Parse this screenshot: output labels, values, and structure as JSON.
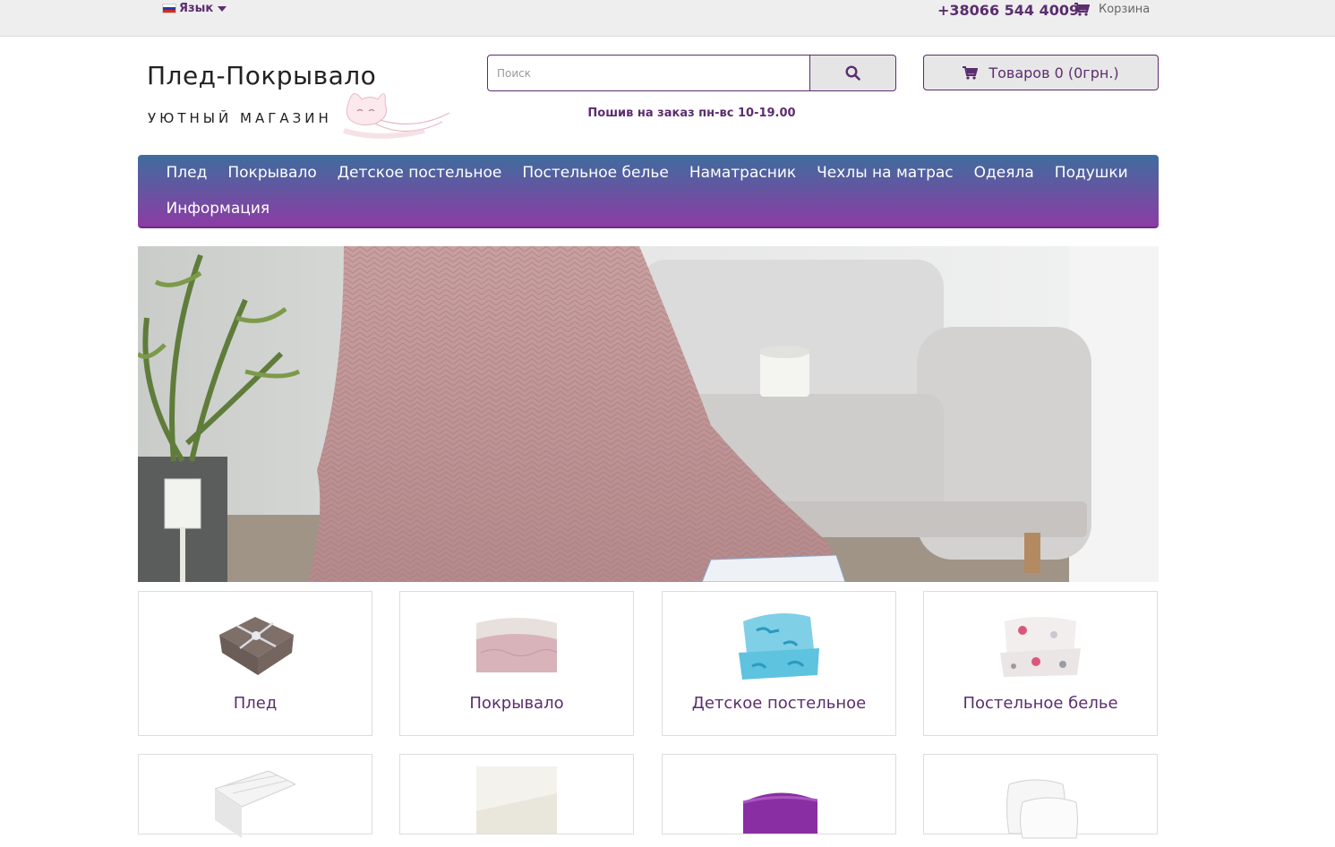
{
  "topbar": {
    "language_label": "Язык",
    "phone": "+38066 544 4009",
    "cart_label": "Корзина"
  },
  "logo": {
    "title": "Плед-Покрывало",
    "subtitle": "УЮТНЫЙ МАГАЗИН"
  },
  "search": {
    "placeholder": "Поиск"
  },
  "promo": "Пошив на заказ  пн-вс 10-19.00",
  "cart_button": "Товаров 0 (0грн.)",
  "menu": [
    "Плед",
    "Покрывало",
    "Детское постельное",
    "Постельное белье",
    "Наматрасник",
    "Чехлы на матрас",
    "Одеяла",
    "Подушки",
    "Информация"
  ],
  "categories": [
    {
      "label": "Плед"
    },
    {
      "label": "Покрывало"
    },
    {
      "label": "Детское постельное"
    },
    {
      "label": "Постельное белье"
    }
  ],
  "colors": {
    "brand": "#5b2d6e",
    "menu_top": "#3f6d9d",
    "menu_bottom": "#8c3ca5"
  }
}
